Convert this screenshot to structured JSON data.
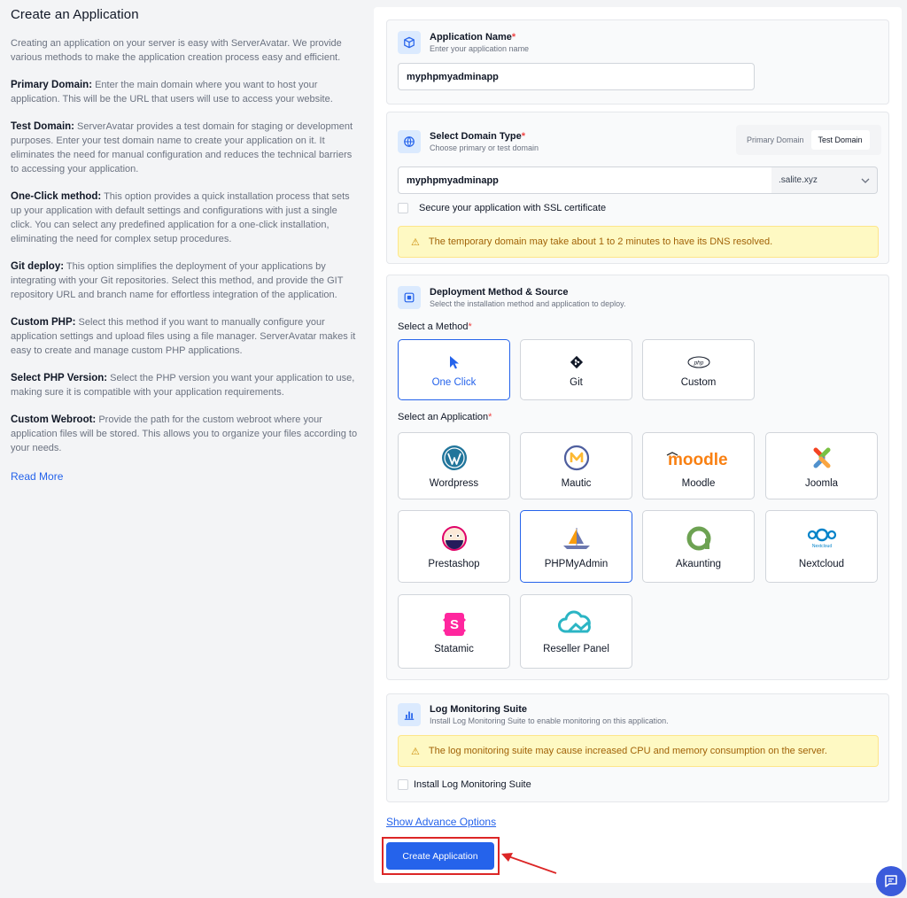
{
  "left": {
    "title": "Create an Application",
    "intro": "Creating an application on your server is easy with ServerAvatar. We provide various methods to make the application creation process easy and efficient.",
    "sections": [
      {
        "term": "Primary Domain:",
        "text": " Enter the main domain where you want to host your application. This will be the URL that users will use to access your website."
      },
      {
        "term": "Test Domain:",
        "text": " ServerAvatar provides a test domain for staging or development purposes. Enter your test domain name to create your application on it. It eliminates the need for manual configuration and reduces the technical barriers to accessing your application."
      },
      {
        "term": "One-Click method:",
        "text": " This option provides a quick installation process that sets up your application with default settings and configurations with just a single click. You can select any predefined application for a one-click installation, eliminating the need for complex setup procedures."
      },
      {
        "term": "Git deploy:",
        "text": " This option simplifies the deployment of your applications by integrating with your Git repositories. Select this method, and provide the GIT repository URL and branch name for effortless integration of the application."
      },
      {
        "term": "Custom PHP:",
        "text": " Select this method if you want to manually configure your application settings and upload files using a file manager. ServerAvatar makes it easy to create and manage custom PHP applications."
      },
      {
        "term": "Select PHP Version:",
        "text": " Select the PHP version you want your application to use, making sure it is compatible with your application requirements."
      },
      {
        "term": "Custom Webroot:",
        "text": " Provide the path for the custom webroot where your application files will be stored. This allows you to organize your files according to your needs."
      }
    ],
    "read_more": "Read More"
  },
  "app_name": {
    "title": "Application Name",
    "required": "*",
    "subtitle": "Enter your application name",
    "value": "myphpmyadminapp"
  },
  "domain": {
    "title": "Select Domain Type",
    "required": "*",
    "subtitle": "Choose primary or test domain",
    "tabs": [
      "Primary Domain",
      "Test Domain"
    ],
    "active_tab": "Test Domain",
    "value": "myphpmyadminapp",
    "suffix": ".salite.xyz",
    "ssl_label": "Secure your application with SSL certificate",
    "ssl_checked": false,
    "warning": "The temporary domain may take about 1 to 2 minutes to have its DNS resolved."
  },
  "deploy": {
    "title": "Deployment Method & Source",
    "subtitle": "Select the installation method and application to deploy.",
    "method_label": "Select a Method",
    "required": "*",
    "methods": [
      {
        "label": "One Click",
        "icon": "cursor-icon",
        "selected": true
      },
      {
        "label": "Git",
        "icon": "git-icon",
        "selected": false
      },
      {
        "label": "Custom",
        "icon": "php-icon",
        "selected": false
      }
    ],
    "app_label": "Select an Application",
    "apps": [
      {
        "label": "Wordpress",
        "icon": "wordpress-icon",
        "selected": false
      },
      {
        "label": "Mautic",
        "icon": "mautic-icon",
        "selected": false
      },
      {
        "label": "Moodle",
        "icon": "moodle-logo",
        "selected": false
      },
      {
        "label": "Joomla",
        "icon": "joomla-icon",
        "selected": false
      },
      {
        "label": "Prestashop",
        "icon": "prestashop-icon",
        "selected": false
      },
      {
        "label": "PHPMyAdmin",
        "icon": "phpmyadmin-icon",
        "selected": true
      },
      {
        "label": "Akaunting",
        "icon": "akaunting-icon",
        "selected": false
      },
      {
        "label": "Nextcloud",
        "icon": "nextcloud-icon",
        "selected": false
      },
      {
        "label": "Statamic",
        "icon": "statamic-icon",
        "selected": false
      },
      {
        "label": "Reseller Panel",
        "icon": "reseller-panel-icon",
        "selected": false
      }
    ],
    "moodle_logo_text": "moodle",
    "nextcloud_logo_text": "Nextcloud"
  },
  "log": {
    "title": "Log Monitoring Suite",
    "subtitle": "Install Log Monitoring Suite to enable monitoring on this application.",
    "warning": "The log monitoring suite may cause increased CPU and memory consumption on the server.",
    "checkbox_label": "Install Log Monitoring Suite",
    "checked": false
  },
  "advanced_link": "Show Advance Options",
  "submit_label": "Create Application",
  "colors": {
    "accent": "#2563eb",
    "highlight": "#dc2626",
    "warning_bg": "#fef9c3",
    "warning_text": "#a16207"
  }
}
